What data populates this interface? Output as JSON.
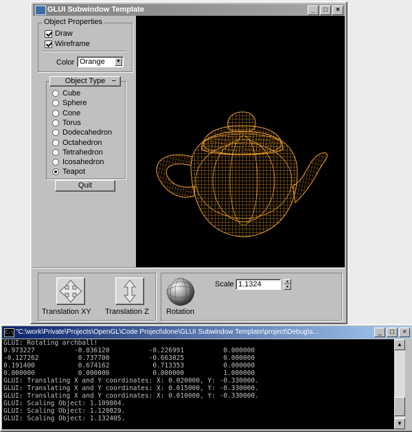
{
  "glui_window": {
    "title": "GLUI Subwindow Template",
    "controls": {
      "minimize": "_",
      "maximize": "□",
      "close": "×"
    },
    "object_properties": {
      "title": "Object Properties",
      "draw_label": "Draw",
      "draw_checked": true,
      "wireframe_label": "Wireframe",
      "wireframe_checked": true,
      "color_label": "Color",
      "color_value": "Orange"
    },
    "object_type": {
      "title": "Object Type",
      "collapse_label": "−",
      "options": [
        "Cube",
        "Sphere",
        "Cone",
        "Torus",
        "Dodecahedron",
        "Octahedron",
        "Tetrahedron",
        "Icosahedron",
        "Teapot"
      ],
      "selected": "Teapot"
    },
    "quit_label": "Quit",
    "viewport": {
      "object": "teapot",
      "render_mode": "wireframe",
      "wire_color": "#f0a030",
      "background": "#000000"
    },
    "bottom": {
      "translation_xy_label": "Translation XY",
      "translation_z_label": "Translation Z",
      "rotation_label": "Rotation",
      "scale_label": "Scale",
      "scale_value": "1.1324"
    }
  },
  "console": {
    "title": "\"C:\\work\\Private\\Projects\\OpenGL\\Code Project\\done\\GLUI Subwindow Template\\project\\Debug\\s...",
    "icon_text": "C:\\",
    "controls": {
      "minimize": "_",
      "maximize": "□",
      "close": "×"
    },
    "lines": [
      "GLUI: Rotating archball!",
      "0.973227          -0.036120          -0.226991          0.000000",
      "-0.127262          0.737700          -0.663025          0.000000",
      "0.191400           0.674162           0.713353          0.000000",
      "0.000000           0.000000           0.000000          1.000000",
      "GLUI: Translating X and Y coordinates: X: 0.020000, Y: -0.330000.",
      "GLUI: Translating X and Y coordinates: X: 0.015000, Y: -0.330000.",
      "GLUI: Translating X and Y coordinates: X: 0.010000, Y: -0.330000.",
      "GLUI: Scaling Object: 1.109804.",
      "GLUI: Scaling Object: 1.120829.",
      "GLUI: Scaling Object: 1.132405."
    ],
    "text_color": "#c0c0c0",
    "background": "#000000"
  }
}
